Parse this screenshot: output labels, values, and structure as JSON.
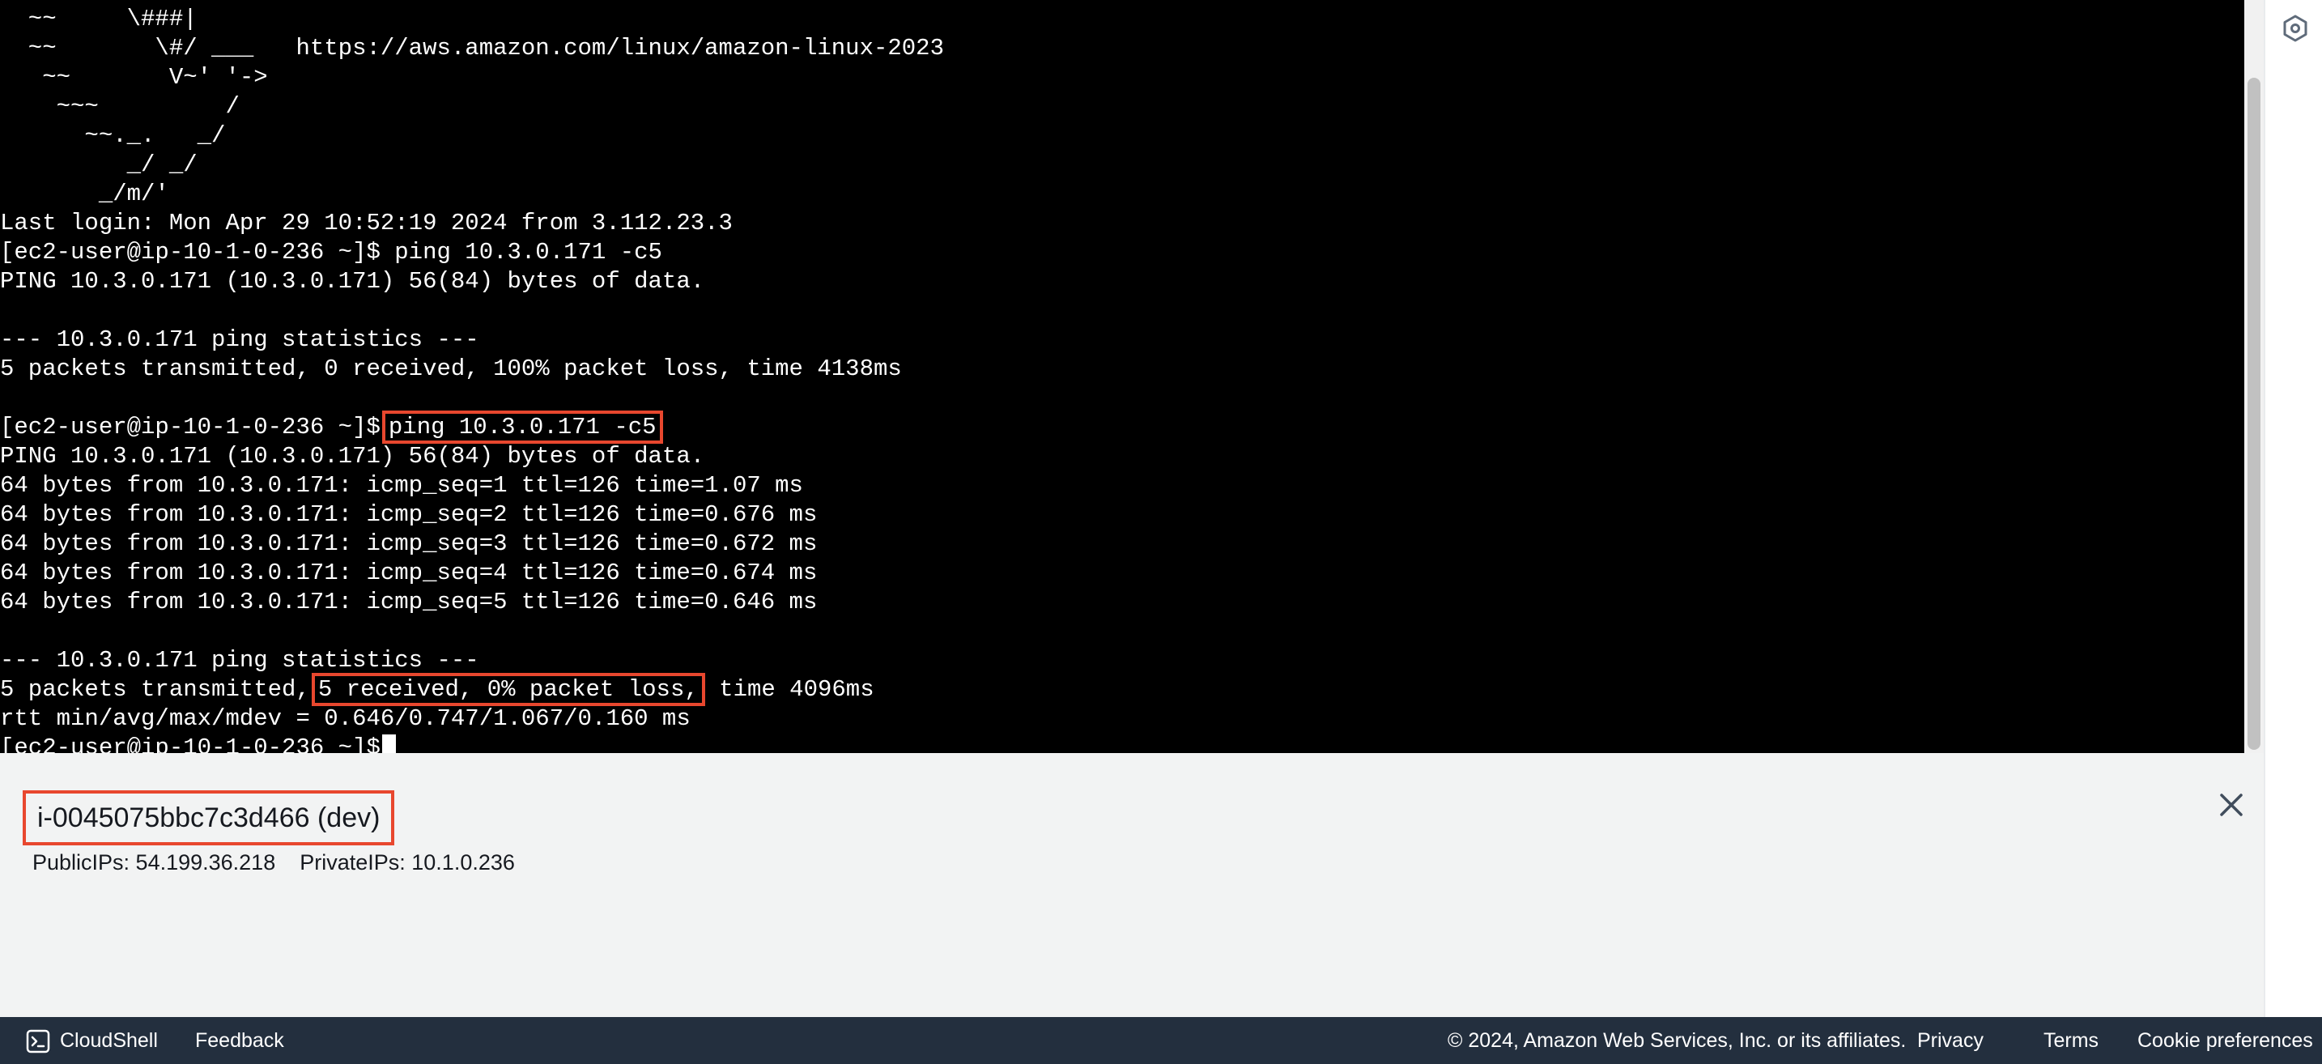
{
  "terminal": {
    "lines": [
      "  ~~     \\###|",
      "  ~~       \\#/ ___   https://aws.amazon.com/linux/amazon-linux-2023",
      "   ~~       V~' '->",
      "    ~~~         /",
      "      ~~._.   _/",
      "         _/ _/",
      "       _/m/'",
      "Last login: Mon Apr 29 10:52:19 2024 from 3.112.23.3",
      "[ec2-user@ip-10-1-0-236 ~]$ ping 10.3.0.171 -c5",
      "PING 10.3.0.171 (10.3.0.171) 56(84) bytes of data.",
      "",
      "--- 10.3.0.171 ping statistics ---",
      "5 packets transmitted, 0 received, 100% packet loss, time 4138ms",
      ""
    ],
    "cmd_prompt": "[ec2-user@ip-10-1-0-236 ~]$",
    "cmd_highlighted": "ping 10.3.0.171 -c5",
    "lines_after_cmd": [
      "PING 10.3.0.171 (10.3.0.171) 56(84) bytes of data.",
      "64 bytes from 10.3.0.171: icmp_seq=1 ttl=126 time=1.07 ms",
      "64 bytes from 10.3.0.171: icmp_seq=2 ttl=126 time=0.676 ms",
      "64 bytes from 10.3.0.171: icmp_seq=3 ttl=126 time=0.672 ms",
      "64 bytes from 10.3.0.171: icmp_seq=4 ttl=126 time=0.674 ms",
      "64 bytes from 10.3.0.171: icmp_seq=5 ttl=126 time=0.646 ms",
      "",
      "--- 10.3.0.171 ping statistics ---"
    ],
    "stats_prefix": "5 packets transmitted,",
    "stats_highlighted": "5 received, 0% packet loss,",
    "stats_suffix": "time 4096ms",
    "rtt_line": "rtt min/avg/max/mdev = 0.646/0.747/1.067/0.160 ms",
    "final_prompt": "[ec2-user@ip-10-1-0-236 ~]$"
  },
  "instance": {
    "title": "i-0045075bbc7c3d466 (dev)",
    "public_ips": "PublicIPs: 54.199.36.218",
    "private_ips": "PrivateIPs: 10.1.0.236",
    "close_icon": "close-icon"
  },
  "footer": {
    "cloudshell_icon": "cloudshell-icon",
    "cloudshell_label": "CloudShell",
    "feedback_label": "Feedback",
    "copyright": "© 2024, Amazon Web Services, Inc. or its affiliates.",
    "privacy": "Privacy",
    "terms": "Terms",
    "cookie_preferences": "Cookie preferences"
  },
  "rail": {
    "icon": "hexagon-settings-icon"
  },
  "colors": {
    "terminal_bg": "#000000",
    "terminal_fg": "#ffffff",
    "highlight_border": "#e8472e",
    "panel_bg": "#f2f3f3",
    "footer_bg": "#232f3e"
  }
}
